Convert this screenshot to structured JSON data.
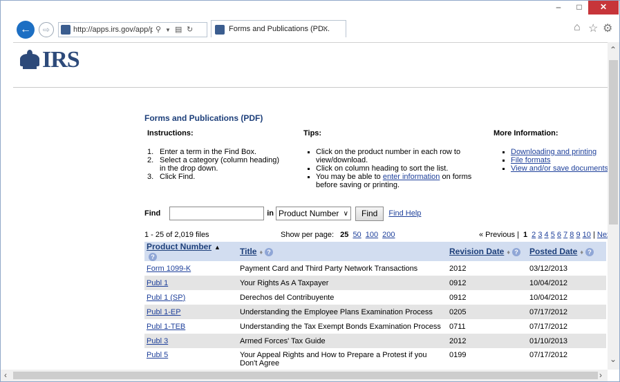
{
  "browser": {
    "url_host": "http://apps.irs.gov",
    "url_path": "/app/picl",
    "tab_title": "Forms and Publications (PD...",
    "win_min": "–",
    "win_max": "□",
    "win_close": "✕"
  },
  "logo": {
    "text": "IRS"
  },
  "page": {
    "title": "Forms and Publications (PDF)",
    "instructions_heading": "Instructions:",
    "tips_heading": "Tips:",
    "more_heading": "More Information:",
    "instructions": [
      {
        "num": "1.",
        "text": "Enter a term in the Find Box."
      },
      {
        "num": "2.",
        "text": "Select a category (column heading) in the drop down."
      },
      {
        "num": "3.",
        "text": "Click Find."
      }
    ],
    "tips": {
      "t1": "Click on the product number in each row to view/download.",
      "t2": "Click on column heading to sort the list.",
      "t3_before": "You may be able to ",
      "t3_link": "enter information",
      "t3_after": " on forms before saving or printing."
    },
    "more_links": [
      "Downloading and printing",
      "File formats",
      "View and/or save documents"
    ]
  },
  "find": {
    "label": "Find",
    "value": "",
    "in_label": "in",
    "category": "Product Number",
    "button": "Find",
    "help": "Find Help"
  },
  "results": {
    "count": "1 - 25 of 2,019 files",
    "per_page_label": "Show per page:",
    "per_page_current": "25",
    "per_page_options": [
      "50",
      "100",
      "200"
    ],
    "prev": "« Previous |",
    "current_page": "1",
    "pages": [
      "2",
      "3",
      "4",
      "5",
      "6",
      "7",
      "8",
      "9",
      "10"
    ],
    "sep": "|",
    "next": "Next »"
  },
  "table": {
    "headers": {
      "product": "Product Number",
      "title": "Title",
      "revision": "Revision Date",
      "posted": "Posted Date"
    },
    "rows": [
      {
        "product": "Form 1099-K",
        "title": "Payment Card and Third Party Network Transactions",
        "revision": "2012",
        "posted": "03/12/2013"
      },
      {
        "product": "Publ 1",
        "title": "Your Rights As A Taxpayer",
        "revision": "0912",
        "posted": "10/04/2012"
      },
      {
        "product": "Publ 1 (SP)",
        "title": "Derechos del Contribuyente",
        "revision": "0912",
        "posted": "10/04/2012"
      },
      {
        "product": "Publ 1-EP",
        "title": "Understanding the Employee Plans Examination Process",
        "revision": "0205",
        "posted": "07/17/2012"
      },
      {
        "product": "Publ 1-TEB",
        "title": "Understanding the Tax Exempt Bonds Examination Process",
        "revision": "0711",
        "posted": "07/17/2012"
      },
      {
        "product": "Publ 3",
        "title": "Armed Forces' Tax Guide",
        "revision": "2012",
        "posted": "01/10/2013"
      },
      {
        "product": "Publ 5",
        "title": "Your Appeal Rights and How to Prepare a Protest if you Don't Agree",
        "revision": "0199",
        "posted": "07/17/2012"
      }
    ]
  }
}
